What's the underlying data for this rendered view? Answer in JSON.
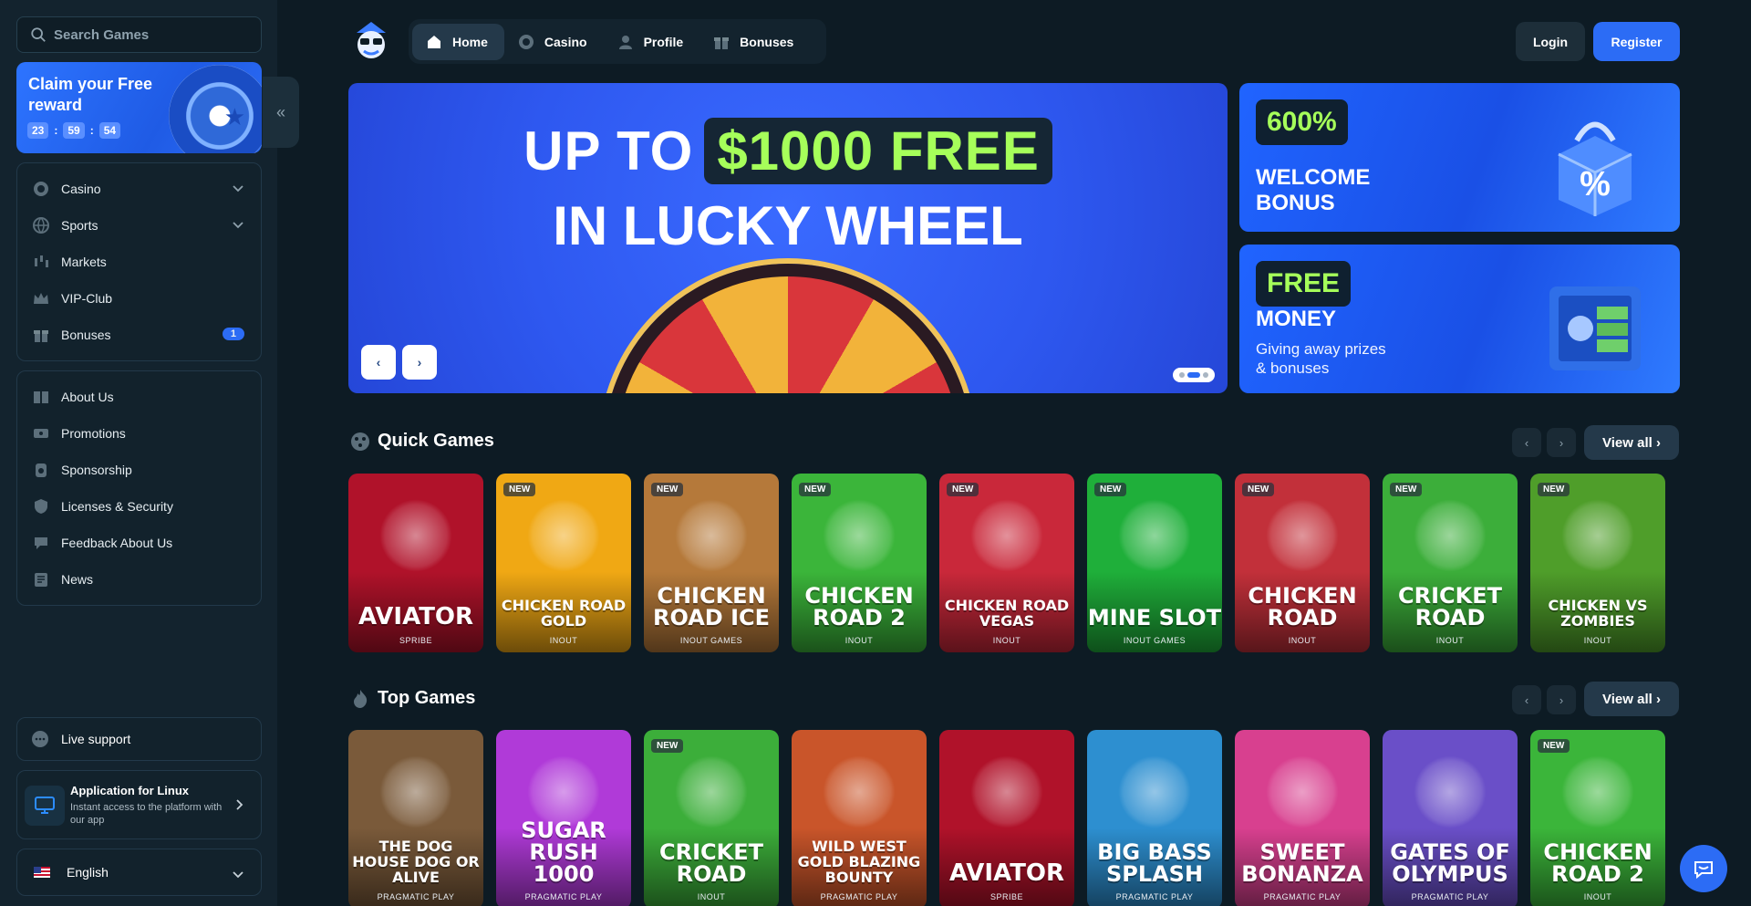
{
  "sidebar": {
    "search_placeholder": "Search Games",
    "claim": {
      "title": "Claim your Free reward",
      "timer": [
        "23",
        "59",
        "54"
      ]
    },
    "main_nav": [
      {
        "label": "Casino",
        "icon": "casino-chip-icon",
        "has_dropdown": true
      },
      {
        "label": "Sports",
        "icon": "globe-ball-icon",
        "has_dropdown": true
      },
      {
        "label": "Markets",
        "icon": "candlestick-icon"
      },
      {
        "label": "VIP-Club",
        "icon": "crown-icon"
      },
      {
        "label": "Bonuses",
        "icon": "gift-icon",
        "badge": "1"
      }
    ],
    "info_nav": [
      {
        "label": "About Us",
        "icon": "book-icon"
      },
      {
        "label": "Promotions",
        "icon": "ticket-icon"
      },
      {
        "label": "Sponsorship",
        "icon": "sponsor-icon"
      },
      {
        "label": "Licenses & Security",
        "icon": "shield-icon"
      },
      {
        "label": "Feedback About Us",
        "icon": "feedback-icon"
      },
      {
        "label": "News",
        "icon": "news-icon"
      }
    ],
    "live_support": "Live support",
    "app": {
      "title": "Application for Linux",
      "desc": "Instant access to the platform with our app"
    },
    "language": "English"
  },
  "header": {
    "tabs": [
      {
        "label": "Home",
        "icon": "home-icon",
        "active": true
      },
      {
        "label": "Casino",
        "icon": "casino-chip-icon"
      },
      {
        "label": "Profile",
        "icon": "user-icon"
      },
      {
        "label": "Bonuses",
        "icon": "gift-icon"
      }
    ],
    "login": "Login",
    "register": "Register"
  },
  "hero": {
    "line1_prefix": "UP TO",
    "line1_highlight": "$1000 FREE",
    "line2": "IN LUCKY WHEEL",
    "prev": "‹",
    "next": "›"
  },
  "promos": [
    {
      "pill": "600%",
      "title": "WELCOME BONUS",
      "subtitle": ""
    },
    {
      "pill": "FREE",
      "title": "MONEY",
      "subtitle": "Giving away prizes & bonuses"
    }
  ],
  "sections": {
    "quick": {
      "title": "Quick Games",
      "view_all": "View all"
    },
    "top": {
      "title": "Top Games",
      "view_all": "View all"
    }
  },
  "quick_games": [
    {
      "name": "AVIATOR",
      "provider": "SPRIBE",
      "new": false,
      "color": "#b0122a"
    },
    {
      "name": "CHICKEN ROAD GOLD",
      "provider": "INOUT",
      "new": true,
      "color": "#f0a814"
    },
    {
      "name": "CHICKEN ROAD ICE",
      "provider": "INOUT GAMES",
      "new": true,
      "color": "#b5793a"
    },
    {
      "name": "CHICKEN ROAD 2",
      "provider": "INOUT",
      "new": true,
      "color": "#3bb53a"
    },
    {
      "name": "CHICKEN ROAD VEGAS",
      "provider": "INOUT",
      "new": true,
      "color": "#c9283a"
    },
    {
      "name": "MINE SLOT",
      "provider": "INOUT GAMES",
      "new": true,
      "color": "#1faf3a"
    },
    {
      "name": "CHICKEN ROAD",
      "provider": "INOUT",
      "new": true,
      "color": "#c2303a"
    },
    {
      "name": "CRICKET ROAD",
      "provider": "INOUT",
      "new": true,
      "color": "#3cae3a"
    },
    {
      "name": "CHICKEN VS ZOMBIES",
      "provider": "INOUT",
      "new": true,
      "color": "#4f9e2a"
    }
  ],
  "top_games": [
    {
      "name": "THE DOG HOUSE DOG OR ALIVE",
      "provider": "PRAGMATIC PLAY",
      "new": false,
      "color": "#7a5a3a"
    },
    {
      "name": "SUGAR RUSH 1000",
      "provider": "PRAGMATIC PLAY",
      "new": false,
      "color": "#b03ad8"
    },
    {
      "name": "CRICKET ROAD",
      "provider": "INOUT",
      "new": true,
      "color": "#3cae3a"
    },
    {
      "name": "WILD WEST GOLD BLAZING BOUNTY",
      "provider": "PRAGMATIC PLAY",
      "new": false,
      "color": "#c9552a"
    },
    {
      "name": "AVIATOR",
      "provider": "SPRIBE",
      "new": false,
      "color": "#b0122a"
    },
    {
      "name": "BIG BASS SPLASH",
      "provider": "PRAGMATIC PLAY",
      "new": false,
      "color": "#2d8fd0"
    },
    {
      "name": "SWEET BONANZA",
      "provider": "PRAGMATIC PLAY",
      "new": false,
      "color": "#d8408f"
    },
    {
      "name": "GATES OF OLYMPUS",
      "provider": "PRAGMATIC PLAY",
      "new": false,
      "color": "#6a4fc8"
    },
    {
      "name": "CHICKEN ROAD 2",
      "provider": "INOUT",
      "new": true,
      "color": "#3bb53a"
    }
  ],
  "new_badge": "NEW"
}
